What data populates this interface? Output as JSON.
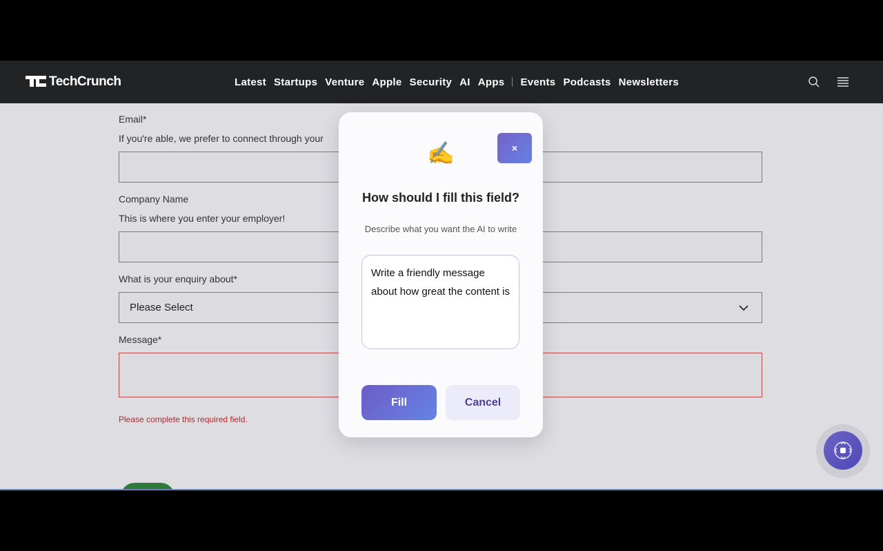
{
  "header": {
    "logo_text": "TechCrunch",
    "nav": [
      "Latest",
      "Startups",
      "Venture",
      "Apple",
      "Security",
      "AI",
      "Apps"
    ],
    "nav_secondary": [
      "Events",
      "Podcasts",
      "Newsletters"
    ]
  },
  "form": {
    "email_label": "Email*",
    "email_help": "If you're able, we prefer to connect through your",
    "company_label": "Company Name",
    "company_help": "This is where you enter your employer!",
    "enquiry_label": "What is your enquiry about*",
    "enquiry_value": "Please Select",
    "message_label": "Message*",
    "message_error": "Please complete this required field."
  },
  "modal": {
    "emoji": "✍️",
    "close_label": "×",
    "title": "How should I fill this field?",
    "subtitle": "Describe what you want the AI to write",
    "prompt_value": "Write a friendly message about how great the content is",
    "fill_label": "Fill",
    "cancel_label": "Cancel"
  },
  "colors": {
    "accent": "#6c5cc6",
    "error": "#b7262b",
    "header_bg": "#222324"
  }
}
